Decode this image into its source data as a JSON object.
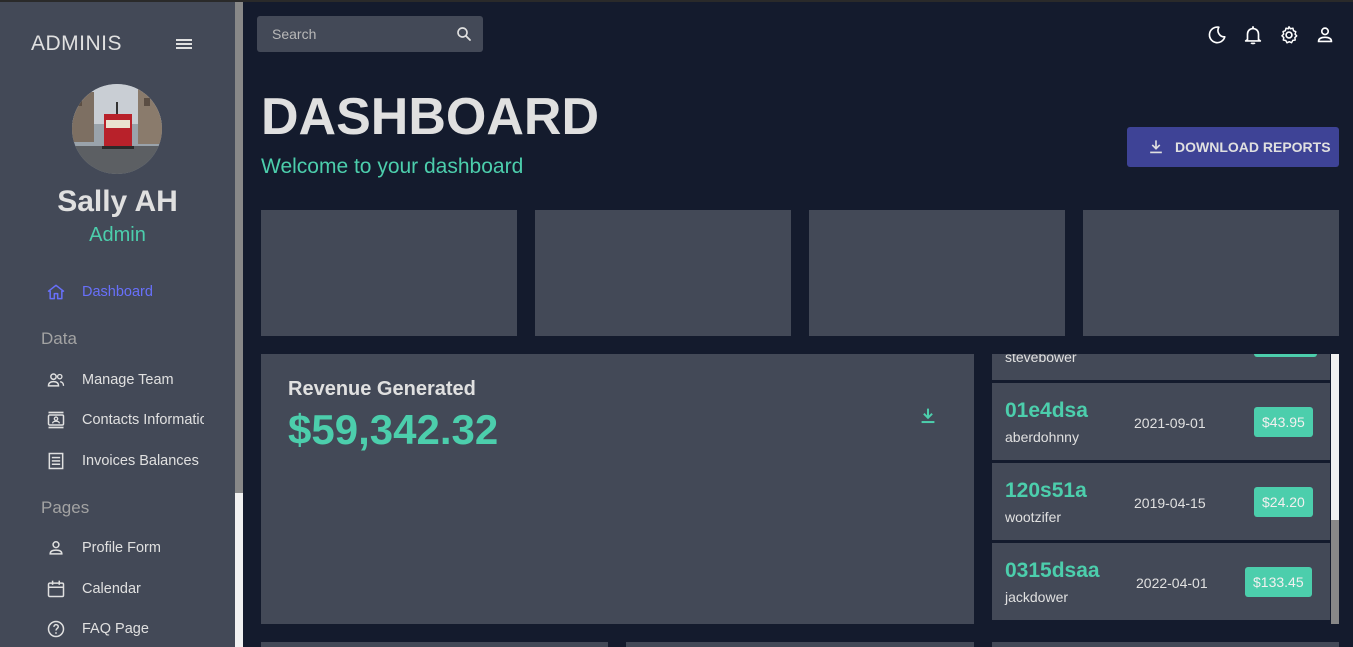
{
  "sidebar": {
    "brand": "ADMINIS",
    "user": {
      "name": "Sally AH",
      "role": "Admin"
    },
    "items": [
      {
        "label": "Dashboard",
        "icon": "home-icon",
        "active": true
      },
      {
        "label": "Manage Team",
        "icon": "people-icon"
      },
      {
        "label": "Contacts Information",
        "icon": "contacts-icon"
      },
      {
        "label": "Invoices Balances",
        "icon": "receipt-icon"
      },
      {
        "label": "Profile Form",
        "icon": "person-icon"
      },
      {
        "label": "Calendar",
        "icon": "calendar-icon"
      },
      {
        "label": "FAQ Page",
        "icon": "help-icon"
      }
    ],
    "sections": {
      "data": "Data",
      "pages": "Pages"
    }
  },
  "topbar": {
    "search_placeholder": "Search",
    "icons": [
      "dark-mode-icon",
      "notifications-icon",
      "settings-icon",
      "person-icon"
    ]
  },
  "header": {
    "title": "DASHBOARD",
    "subtitle": "Welcome to your dashboard",
    "download_label": "DOWNLOAD REPORTS"
  },
  "revenue": {
    "title": "Revenue Generated",
    "value": "$59,342.32"
  },
  "transactions": [
    {
      "txId": "",
      "user": "stevebower",
      "date": "",
      "cost": ""
    },
    {
      "txId": "01e4dsa",
      "user": "aberdohnny",
      "date": "2021-09-01",
      "cost": "$43.95"
    },
    {
      "txId": "120s51a",
      "user": "wootzifer",
      "date": "2019-04-15",
      "cost": "$24.20"
    },
    {
      "txId": "0315dsaa",
      "user": "jackdower",
      "date": "2022-04-01",
      "cost": "$133.45"
    }
  ],
  "colors": {
    "background": "#141b2d",
    "panel": "#434957",
    "accent_green": "#4cceac",
    "accent_blue": "#6870fa",
    "button": "#3e4396"
  }
}
